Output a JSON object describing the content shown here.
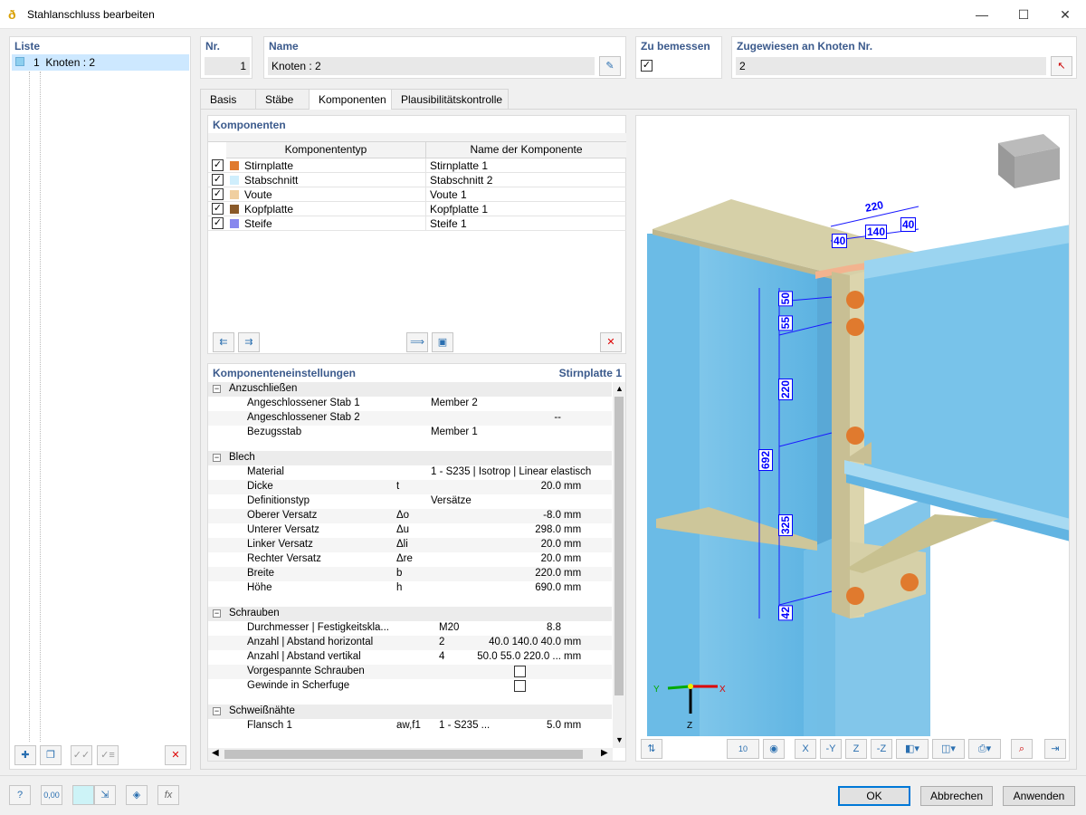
{
  "window": {
    "title": "Stahlanschluss bearbeiten",
    "minimize": "—",
    "maximize": "☐",
    "close": "✕"
  },
  "list": {
    "header": "Liste",
    "items": [
      {
        "no": "1",
        "label": "Knoten : 2"
      }
    ]
  },
  "nr": {
    "label": "Nr.",
    "value": "1"
  },
  "name": {
    "label": "Name",
    "value": "Knoten : 2"
  },
  "design": {
    "label": "Zu bemessen",
    "checked": true
  },
  "assigned": {
    "label": "Zugewiesen an Knoten Nr.",
    "value": "2"
  },
  "tabs": [
    "Basis",
    "Stäbe",
    "Komponenten",
    "Plausibilitätskontrolle"
  ],
  "components": {
    "header": "Komponenten",
    "col_type": "Komponententyp",
    "col_name": "Name der Komponente",
    "rows": [
      {
        "type": "Stirnplatte",
        "name": "Stirnplatte 1",
        "color": "#e07a2e"
      },
      {
        "type": "Stabschnitt",
        "name": "Stabschnitt 2",
        "color": "#cfeefc"
      },
      {
        "type": "Voute",
        "name": "Voute 1",
        "color": "#f0cfa0"
      },
      {
        "type": "Kopfplatte",
        "name": "Kopfplatte 1",
        "color": "#8a5a2a"
      },
      {
        "type": "Steife",
        "name": "Steife 1",
        "color": "#8888ee"
      }
    ]
  },
  "settings": {
    "header": "Komponenteneinstellungen",
    "selected": "Stirnplatte 1",
    "groups": [
      {
        "title": "Anzuschließen",
        "rows": [
          {
            "name": "Angeschlossener Stab 1",
            "sym": "",
            "val": "Member 2",
            "unit": ""
          },
          {
            "name": "Angeschlossener Stab 2",
            "sym": "",
            "val": "--",
            "unit": ""
          },
          {
            "name": "Bezugsstab",
            "sym": "",
            "val": "Member 1",
            "unit": ""
          }
        ]
      },
      {
        "title": "Blech",
        "rows": [
          {
            "name": "Material",
            "sym": "",
            "val": "1 - S235 | Isotrop | Linear elastisch",
            "unit": ""
          },
          {
            "name": "Dicke",
            "sym": "t",
            "val": "20.0",
            "unit": "mm"
          },
          {
            "name": "Definitionstyp",
            "sym": "",
            "val": "Versätze",
            "unit": ""
          },
          {
            "name": "Oberer Versatz",
            "sym": "Δo",
            "val": "-8.0",
            "unit": "mm"
          },
          {
            "name": "Unterer Versatz",
            "sym": "Δu",
            "val": "298.0",
            "unit": "mm"
          },
          {
            "name": "Linker Versatz",
            "sym": "Δli",
            "val": "20.0",
            "unit": "mm"
          },
          {
            "name": "Rechter Versatz",
            "sym": "Δre",
            "val": "20.0",
            "unit": "mm"
          },
          {
            "name": "Breite",
            "sym": "b",
            "val": "220.0",
            "unit": "mm"
          },
          {
            "name": "Höhe",
            "sym": "h",
            "val": "690.0",
            "unit": "mm"
          }
        ]
      },
      {
        "title": "Schrauben",
        "rows": [
          {
            "name": "Durchmesser | Festigkeitskla...",
            "sym": "",
            "val": "M20",
            "val2": "8.8",
            "unit": ""
          },
          {
            "name": "Anzahl | Abstand horizontal",
            "sym": "",
            "val": "2",
            "val2": "40.0 140.0 40.0",
            "unit": "mm"
          },
          {
            "name": "Anzahl | Abstand vertikal",
            "sym": "",
            "val": "4",
            "val2": "50.0 55.0 220.0 ...",
            "unit": "mm"
          },
          {
            "name": "Vorgespannte Schrauben",
            "sym": "",
            "val": "",
            "unit": ""
          },
          {
            "name": "Gewinde in Scherfuge",
            "sym": "",
            "val": "",
            "unit": ""
          }
        ]
      },
      {
        "title": "Schweißnähte",
        "rows": [
          {
            "name": "Flansch 1",
            "sym": "aw,f1",
            "val": "1 - S235 ...",
            "val2": "5.0",
            "unit": "mm"
          }
        ]
      }
    ]
  },
  "dims": {
    "top_total": "220",
    "top_left": "40",
    "top_mid": "140",
    "top_right": "40",
    "v1": "50",
    "v2": "55",
    "v3": "220",
    "v4": "325",
    "v5": "42",
    "total": "692"
  },
  "axes": {
    "x": "X",
    "y": "Y",
    "z": "Z"
  },
  "viewbar": {
    "scale": "10"
  },
  "buttons": {
    "ok": "OK",
    "cancel": "Abbrechen",
    "apply": "Anwenden"
  },
  "footer": {
    "zero": "0,00"
  }
}
